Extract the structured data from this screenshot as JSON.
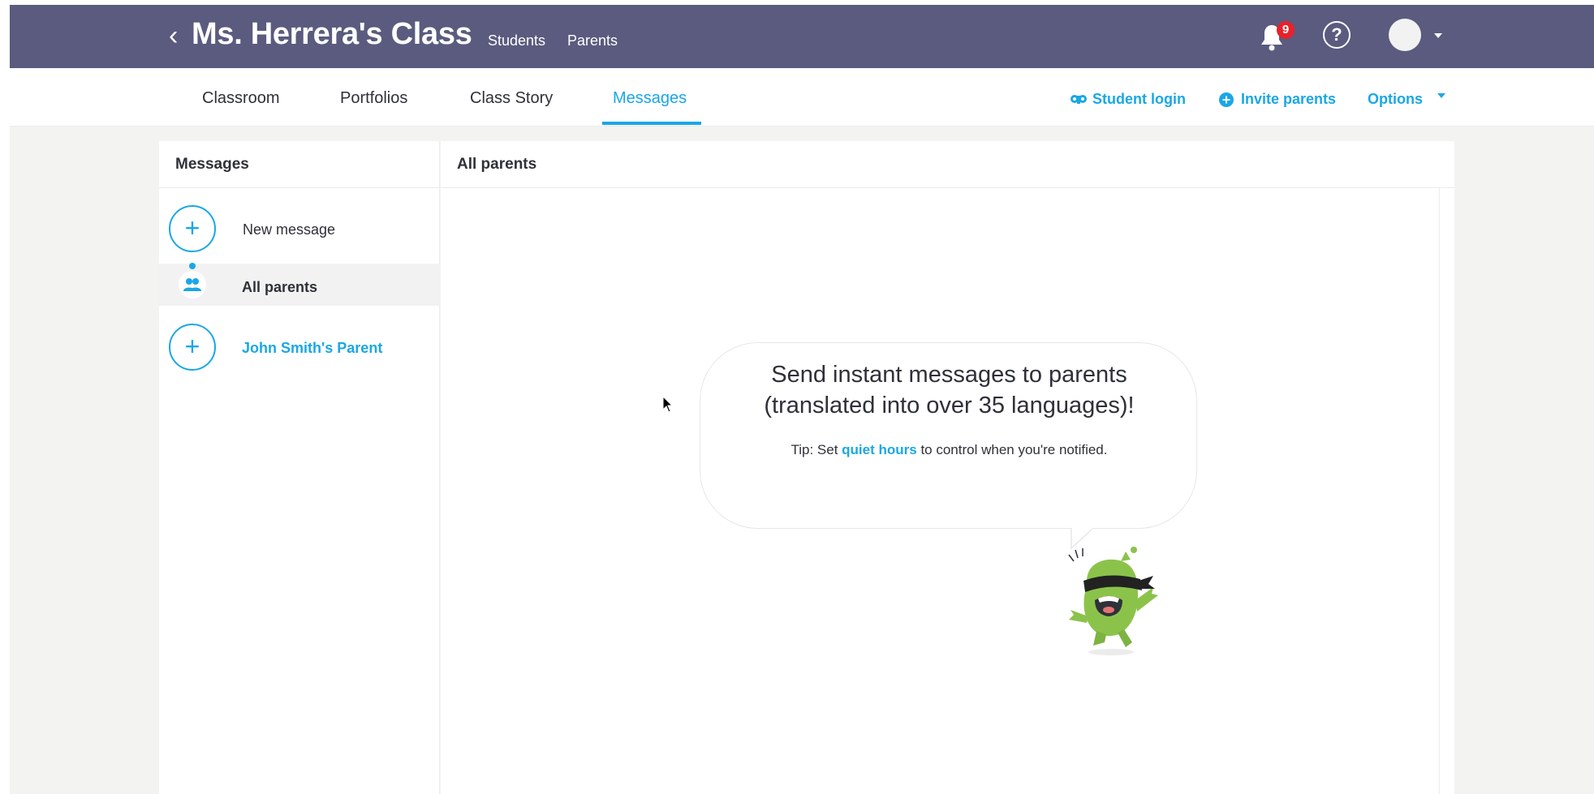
{
  "header": {
    "back_glyph": "‹",
    "class_title": "Ms. Herrera's Class",
    "links": [
      "Students",
      "Parents"
    ],
    "notification_count": "9",
    "help_glyph": "?"
  },
  "nav": {
    "tabs": [
      {
        "label": "Classroom"
      },
      {
        "label": "Portfolios"
      },
      {
        "label": "Class Story"
      },
      {
        "label": "Messages",
        "active": true
      }
    ],
    "actions": {
      "student_login": "Student login",
      "invite_parents": "Invite parents",
      "options": "Options"
    }
  },
  "sidebar": {
    "title": "Messages",
    "new_message": "New message",
    "all_parents": "All parents",
    "contact": "John Smith's Parent"
  },
  "main": {
    "title": "All parents",
    "empty_heading_line1": "Send instant messages to parents",
    "empty_heading_line2": "(translated into over 35 languages)!",
    "tip_prefix": "Tip: Set ",
    "tip_link": "quiet hours",
    "tip_suffix": " to control when you're notified."
  },
  "colors": {
    "header_bg": "#5a5b7e",
    "accent": "#1aa7e6",
    "badge": "#e8212b",
    "page_bg": "#f3f3f2"
  },
  "icons": [
    "back-chevron-icon",
    "bell-icon",
    "help-icon",
    "avatar",
    "student-login-icon",
    "invite-plus-icon",
    "plus-icon",
    "group-icon",
    "monster-mascot"
  ]
}
